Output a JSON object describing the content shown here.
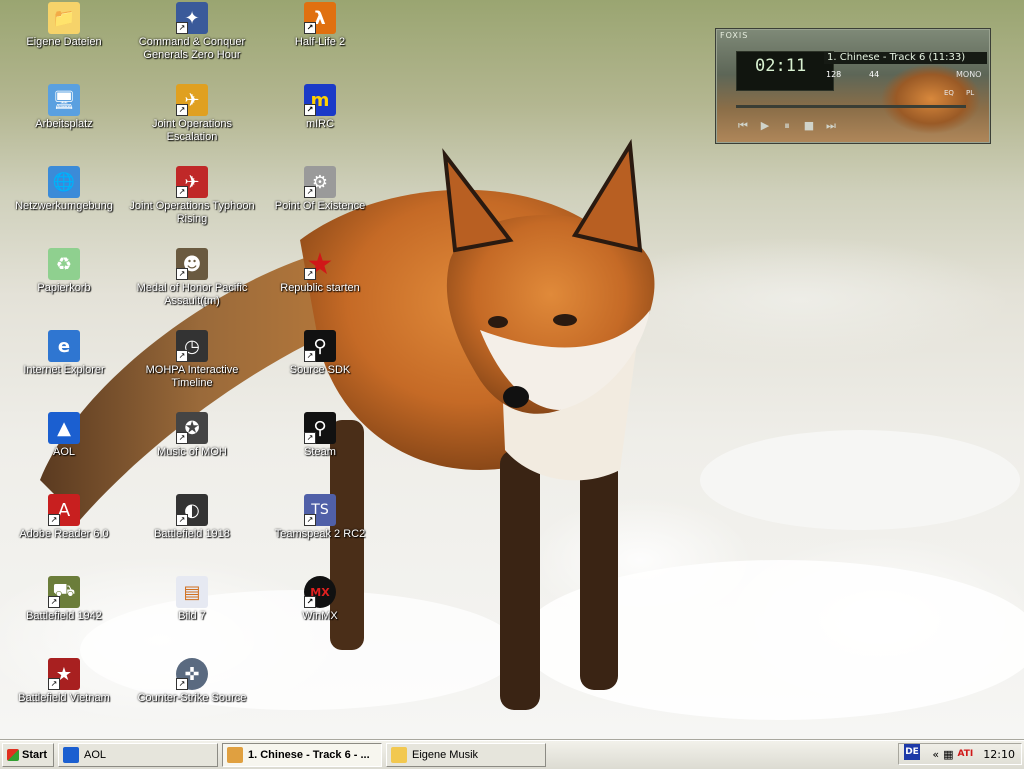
{
  "desktop": {
    "icons": [
      {
        "label": "Eigene Dateien",
        "icon": "my-documents-icon"
      },
      {
        "label": "Arbeitsplatz",
        "icon": "my-computer-icon"
      },
      {
        "label": "Netzwerkumgebung",
        "icon": "network-places-icon"
      },
      {
        "label": "Papierkorb",
        "icon": "recycle-bin-icon"
      },
      {
        "label": "Internet Explorer",
        "icon": "internet-explorer-icon"
      },
      {
        "label": "AOL",
        "icon": "aol-icon"
      },
      {
        "label": "Adobe Reader 6.0",
        "icon": "adobe-reader-icon"
      },
      {
        "label": "Battlefield 1942",
        "icon": "battlefield-1942-icon"
      },
      {
        "label": "Battlefield Vietnam",
        "icon": "battlefield-vietnam-icon"
      },
      {
        "label": "Command & Conquer Generals Zero Hour",
        "icon": "command-conquer-icon"
      },
      {
        "label": "Joint Operations Escalation",
        "icon": "joint-operations-escalation-icon"
      },
      {
        "label": "Joint Operations Typhoon Rising",
        "icon": "joint-operations-typhoon-icon"
      },
      {
        "label": "Medal of Honor Pacific Assault(tm)",
        "icon": "medal-of-honor-icon"
      },
      {
        "label": "MOHPA Interactive Timeline",
        "icon": "mohpa-timeline-icon"
      },
      {
        "label": "Music of MOH",
        "icon": "music-of-moh-icon"
      },
      {
        "label": "Battlefield 1918",
        "icon": "battlefield-1918-icon"
      },
      {
        "label": "Bild 7",
        "icon": "image-file-icon"
      },
      {
        "label": "Counter-Strike Source",
        "icon": "counter-strike-icon"
      },
      {
        "label": "Half-Life 2",
        "icon": "half-life-2-icon"
      },
      {
        "label": "mIRC",
        "icon": "mirc-icon"
      },
      {
        "label": "Point Of Existence",
        "icon": "point-of-existence-icon"
      },
      {
        "label": "Republic starten",
        "icon": "republic-star-icon"
      },
      {
        "label": "Source SDK",
        "icon": "source-sdk-icon"
      },
      {
        "label": "Steam",
        "icon": "steam-icon"
      },
      {
        "label": "Teamspeak 2 RC2",
        "icon": "teamspeak-icon"
      },
      {
        "label": "WinMX",
        "icon": "winmx-icon"
      }
    ]
  },
  "player": {
    "title": "FOXIS",
    "time": "02:11",
    "track": "1. Chinese - Track 6 (11:33)",
    "kbps": "128",
    "khz": "44",
    "mode": "MONO",
    "eq": "EQ",
    "pl": "PL",
    "controls": [
      "prev",
      "play",
      "pause",
      "stop",
      "next"
    ]
  },
  "taskbar": {
    "start": "Start",
    "buttons": [
      {
        "label": "AOL",
        "icon": "aol-icon"
      },
      {
        "label": "1. Chinese - Track 6 - ...",
        "icon": "winamp-icon"
      },
      {
        "label": "Eigene Musik",
        "icon": "folder-icon"
      }
    ],
    "language": "DE",
    "clock": "12:10"
  }
}
